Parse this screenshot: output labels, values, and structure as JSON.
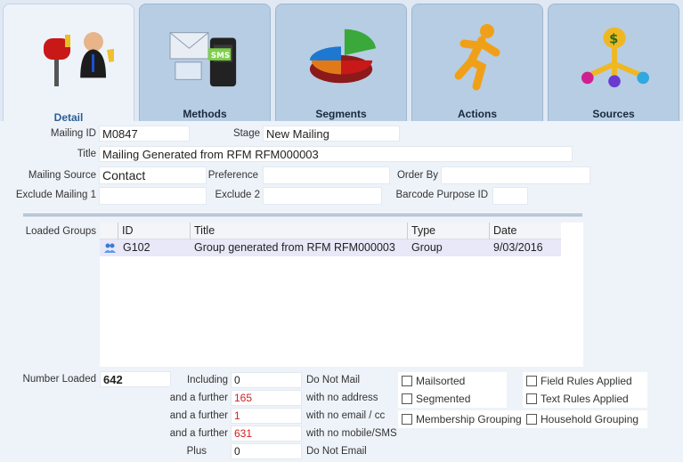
{
  "tabs": [
    {
      "label": "Detail",
      "icon": "mailbox-person-icon"
    },
    {
      "label": "Methods",
      "icon": "envelopes-sms-phone-icon"
    },
    {
      "label": "Segments",
      "icon": "pie-chart-icon"
    },
    {
      "label": "Actions",
      "icon": "running-figure-icon"
    },
    {
      "label": "Sources",
      "icon": "money-bag-sources-icon"
    }
  ],
  "form": {
    "mailing_id_label": "Mailing ID",
    "mailing_id": "M0847",
    "stage_label": "Stage",
    "stage": "New Mailing",
    "title_label": "Title",
    "title": "Mailing Generated from RFM RFM000003",
    "source_label": "Mailing Source",
    "source": "Contact",
    "preference_label": "Preference",
    "preference": "",
    "order_by_label": "Order By",
    "order_by": "",
    "exclude1_label": "Exclude Mailing 1",
    "exclude1": "",
    "exclude2_label": "Exclude 2",
    "exclude2": "",
    "barcode_label": "Barcode Purpose ID",
    "barcode": ""
  },
  "groups": {
    "label": "Loaded Groups",
    "columns": [
      "ID",
      "Title",
      "Type",
      "Date"
    ],
    "rows": [
      {
        "id": "G102",
        "title": "Group generated from RFM RFM000003",
        "type": "Group",
        "date": "9/03/2016"
      }
    ]
  },
  "stats": {
    "number_loaded_label": "Number Loaded",
    "number_loaded": "642",
    "including_label": "Including",
    "including": "0",
    "including_desc": "Do Not Mail",
    "further1_label": "and a further",
    "further1": "165",
    "further1_desc": "with no address",
    "further2_label": "and a further",
    "further2": "1",
    "further2_desc": "with no email / cc",
    "further3_label": "and a further",
    "further3": "631",
    "further3_desc": "with no mobile/SMS",
    "plus_label": "Plus",
    "plus": "0",
    "plus_desc": "Do Not Email"
  },
  "checks": {
    "mailsorted": "Mailsorted",
    "segmented": "Segmented",
    "membership": "Membership Grouping",
    "field_rules": "Field Rules Applied",
    "text_rules": "Text Rules Applied",
    "household": "Household Grouping"
  },
  "colors": {
    "accent": "#2c5f93",
    "red_values": "#d02020",
    "tab_bg": "#b7cde3"
  }
}
